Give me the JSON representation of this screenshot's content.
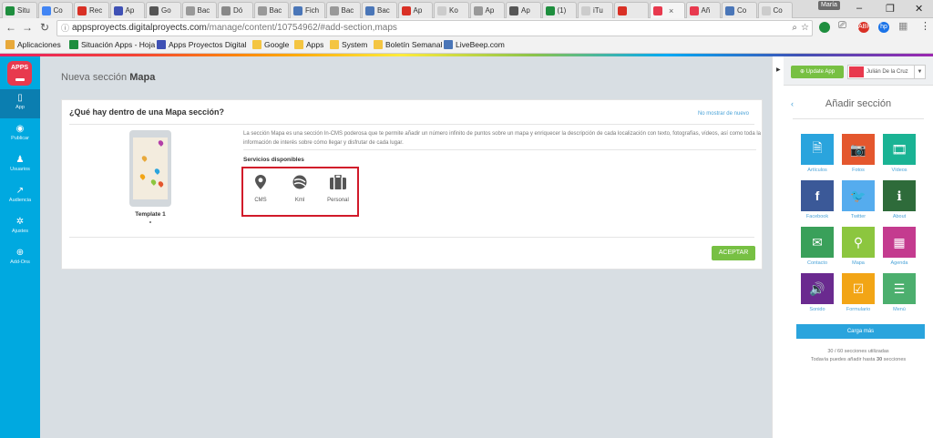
{
  "browser": {
    "tabs": [
      {
        "label": "Situ",
        "color": "#1e8e3e"
      },
      {
        "label": "Co",
        "color": "#4285f4"
      },
      {
        "label": "Rec",
        "color": "#d93025"
      },
      {
        "label": "Ap",
        "color": "#3f51b5"
      },
      {
        "label": "Go",
        "color": "#555555"
      },
      {
        "label": "Bac",
        "color": "#999999"
      },
      {
        "label": "Dó",
        "color": "#888888"
      },
      {
        "label": "Bac",
        "color": "#999999"
      },
      {
        "label": "Fich",
        "color": "#4a76b8"
      },
      {
        "label": "Bac",
        "color": "#999999"
      },
      {
        "label": "Bac",
        "color": "#4a76b8"
      },
      {
        "label": "Ap",
        "color": "#d93025"
      },
      {
        "label": "Ko",
        "color": "#cccccc"
      },
      {
        "label": "Ap",
        "color": "#999999"
      },
      {
        "label": "Ap",
        "color": "#555555"
      },
      {
        "label": "(1)",
        "color": "#1e8e3e"
      },
      {
        "label": "iTu",
        "color": "#cccccc"
      },
      {
        "label": "",
        "color": "#d93025"
      },
      {
        "label": "",
        "color": "#e8394e"
      },
      {
        "label": "Añ",
        "color": "#e8394e"
      },
      {
        "label": "Co",
        "color": "#4a76b8"
      },
      {
        "label": "Co",
        "color": "#cccccc"
      }
    ],
    "active_tab_close": "×",
    "profile_name": "María",
    "window": {
      "minimize": "–",
      "maximize": "❐",
      "close": "✕"
    },
    "url_host": "appsproyects.digitalproyects.com",
    "url_path": "/manage/content/10754962/#add-section,maps",
    "bookmarks": [
      {
        "label": "Aplicaciones",
        "color": "#e8a93b"
      },
      {
        "label": "Situación Apps - Hoja",
        "color": "#1e8e3e"
      },
      {
        "label": "Apps Proyectos Digital",
        "color": "#3f51b5"
      },
      {
        "label": "Google",
        "color": "#f4c542"
      },
      {
        "label": "Apps",
        "color": "#f4c542"
      },
      {
        "label": "System",
        "color": "#f4c542"
      },
      {
        "label": "Boletín Semanal",
        "color": "#f4c542"
      },
      {
        "label": "LiveBeep.com",
        "color": "#4a76b8"
      }
    ]
  },
  "sidebar": {
    "logo": "APPS",
    "items": [
      {
        "label": "App",
        "icon": "▯"
      },
      {
        "label": "Publicar",
        "icon": "◉"
      },
      {
        "label": "Usuarios",
        "icon": "♟"
      },
      {
        "label": "Audiencia",
        "icon": "↗"
      },
      {
        "label": "Ajustes",
        "icon": "✲"
      },
      {
        "label": "Add-Ons",
        "icon": "⊕"
      }
    ]
  },
  "main": {
    "breadcrumb_prefix": "Nueva sección",
    "breadcrumb_bold": "Mapa",
    "card_title": "¿Qué hay dentro de una Mapa sección?",
    "hide_link": "No mostrar de nuevo",
    "template_label": "Template 1",
    "description": "La sección Mapa es una sección In-CMS poderosa que te permite añadir un número infinito de puntos sobre un mapa y enriquecer la descripción de cada localización con texto, fotografías, vídeos, así como toda la información de interés sobre cómo llegar y disfrutar de cada lugar.",
    "services_title": "Servicios disponibles",
    "services": [
      {
        "label": "CMS",
        "icon": "map-pin-icon"
      },
      {
        "label": "Kml",
        "icon": "globe-icon"
      },
      {
        "label": "Personal",
        "icon": "briefcase-icon"
      }
    ],
    "accept_button": "ACEPTAR"
  },
  "right_panel": {
    "update_button": "Update App",
    "user_name": "Julián De la Cruz",
    "title": "Añadir sección",
    "back": "‹",
    "tiles": [
      {
        "label": "Artículos",
        "color": "#2aa4dd",
        "icon": "🗎"
      },
      {
        "label": "Fotos",
        "color": "#e4572e",
        "icon": "📷"
      },
      {
        "label": "Vídeos",
        "color": "#1ab394",
        "icon": "🎞"
      },
      {
        "label": "Facebook",
        "color": "#3b5998",
        "icon": "f"
      },
      {
        "label": "Twitter",
        "color": "#55acee",
        "icon": "🐦"
      },
      {
        "label": "About",
        "color": "#2e6b3a",
        "icon": "ℹ"
      },
      {
        "label": "Contacto",
        "color": "#3aa05a",
        "icon": "✉"
      },
      {
        "label": "Mapa",
        "color": "#8cc63f",
        "icon": "⚲"
      },
      {
        "label": "Agenda",
        "color": "#c43b8f",
        "icon": "▦"
      },
      {
        "label": "Sonido",
        "color": "#6a2a8f",
        "icon": "🔊"
      },
      {
        "label": "Formulario",
        "color": "#f2a516",
        "icon": "☑"
      },
      {
        "label": "Menú",
        "color": "#4caf6e",
        "icon": "☰"
      }
    ],
    "more_button": "Carga más",
    "usage_line": "30 / 60 secciones utilizadas",
    "remaining_prefix": "Todavía puedes añadir hasta",
    "remaining_count": "30",
    "remaining_suffix": "secciones"
  }
}
